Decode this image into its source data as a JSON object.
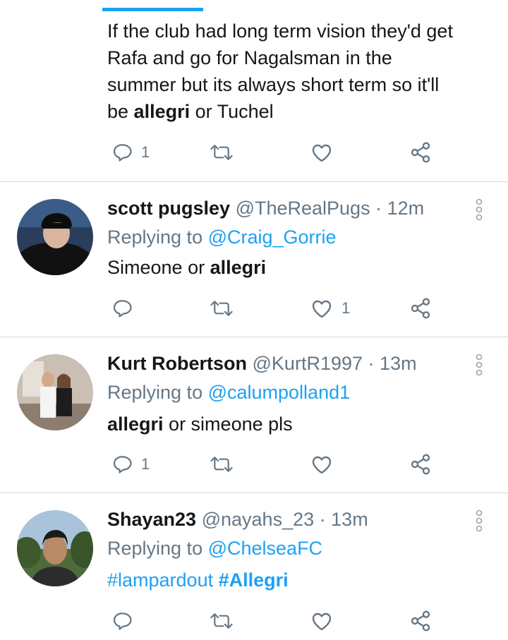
{
  "colors": {
    "accent": "#1da1f2",
    "secondary_text": "#657786",
    "divider": "#d3d8dc"
  },
  "icons": {
    "reply": "reply-icon",
    "retweet": "retweet-icon",
    "like": "heart-icon",
    "share": "share-icon",
    "more": "more-vertical-icon"
  },
  "tweets": [
    {
      "body_lines": [
        "If the club had long term vision they'd get",
        "Rafa and go for Nagalsman in the",
        "summer but its always short term so it'll"
      ],
      "body_last_pre": "be ",
      "body_last_bold": "allegri",
      "body_last_post": " or Tuchel",
      "reply_count": "1",
      "like_count": ""
    },
    {
      "name": "scott pugsley",
      "handle": "@TheRealPugs",
      "separator": "·",
      "time": "12m",
      "replying_prefix": "Replying to ",
      "replying_to": "@Craig_Gorrie",
      "text_pre": "Simeone or ",
      "text_bold": "allegri",
      "reply_count": "",
      "like_count": "1"
    },
    {
      "name": "Kurt Robertson",
      "handle": "@KurtR1997",
      "separator": "·",
      "time": "13m",
      "replying_prefix": "Replying to ",
      "replying_to": "@calumpolland1",
      "text_bold": "allegri",
      "text_post": " or simeone pls",
      "reply_count": "1",
      "like_count": ""
    },
    {
      "name": "Shayan23",
      "handle": "@nayahs_23",
      "separator": "·",
      "time": "13m",
      "replying_prefix": "Replying to ",
      "replying_to": "@ChelseaFC",
      "hashtag1": "#lampardout",
      "hashtag2": "#Allegri",
      "reply_count": "",
      "like_count": ""
    }
  ]
}
